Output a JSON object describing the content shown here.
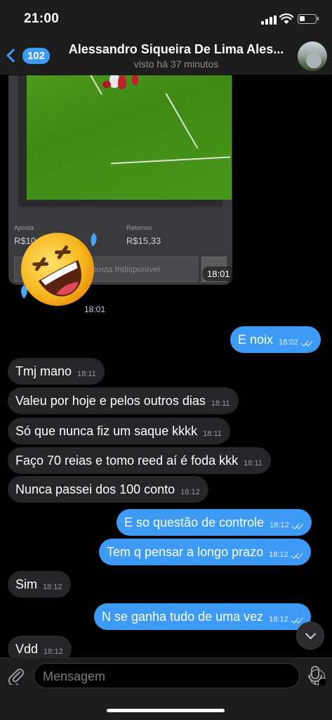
{
  "status_bar": {
    "time": "21:00"
  },
  "header": {
    "back_badge": "102",
    "title": "Alessandro Siqueira De Lima Ales...",
    "subtitle": "visto há 37 minutos"
  },
  "bet_card": {
    "stake_label": "Aposta",
    "stake_value": "R$10,00",
    "returns_label": "Retornos",
    "returns_value": "R$15,33",
    "close_button": "Encerrar Aposta Indisponível",
    "time": "18:01"
  },
  "sticker": {
    "name": "rofl-emoji",
    "time": "18:01"
  },
  "messages": [
    {
      "text": "E noix",
      "time": "18:02",
      "dir": "out"
    },
    {
      "text": "Tmj mano",
      "time": "18:11",
      "dir": "in"
    },
    {
      "text": "Valeu por hoje e pelos outros dias",
      "time": "18:11",
      "dir": "in"
    },
    {
      "text": "Só que nunca fiz um saque kkkk",
      "time": "18:11",
      "dir": "in"
    },
    {
      "text": "Faço 70 reias e tomo reed aí é foda kkk",
      "time": "18:11",
      "dir": "in"
    },
    {
      "text": "Nunca passei dos 100 conto",
      "time": "18:12",
      "dir": "in"
    },
    {
      "text": "E so questão de controle",
      "time": "18:12",
      "dir": "out"
    },
    {
      "text": "Tem q pensar a longo prazo",
      "time": "18:12",
      "dir": "out"
    },
    {
      "text": "Sim",
      "time": "18:12",
      "dir": "in"
    },
    {
      "text": "N se ganha tudo de uma vez",
      "time": "18:12",
      "dir": "out"
    },
    {
      "text": "Vdd",
      "time": "18:12",
      "dir": "in"
    }
  ],
  "composer": {
    "placeholder": "Mensagem"
  },
  "colors": {
    "accent": "#3e9bf5",
    "incoming_bubble": "#262628",
    "background": "#000000",
    "bar": "#1c1c1d"
  }
}
